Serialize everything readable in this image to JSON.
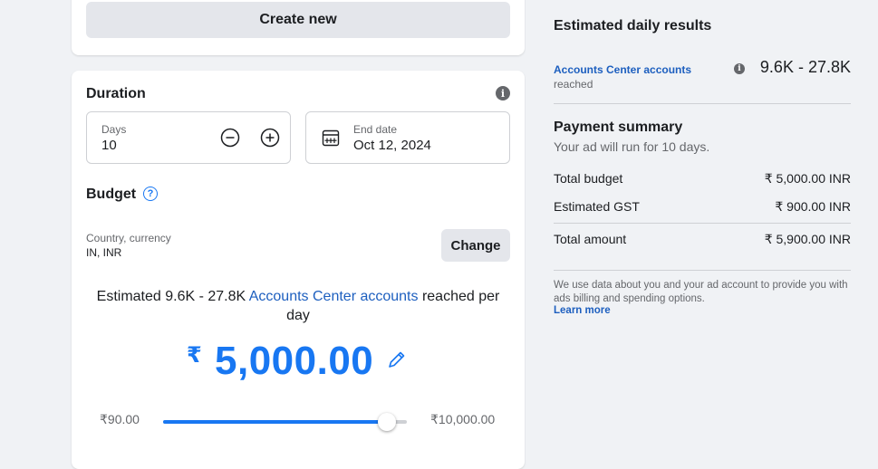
{
  "create_card": {
    "create_button_label": "Create new"
  },
  "duration": {
    "title": "Duration",
    "days_label": "Days",
    "days_value": "10",
    "end_date_label": "End date",
    "end_date_value": "Oct 12, 2024"
  },
  "budget": {
    "title": "Budget",
    "country_label": "Country, currency",
    "country_value": "IN, INR",
    "change_button_label": "Change",
    "estimate_prefix": "Estimated 9.6K - 27.8K ",
    "estimate_link": "Accounts Center accounts",
    "estimate_suffix": " reached per day",
    "currency_symbol": "₹",
    "amount": "5,000.00",
    "min_label": "₹90.00",
    "max_label": "₹10,000.00",
    "slider_position_pct": 92
  },
  "results": {
    "title": "Estimated daily results",
    "accounts_link": "Accounts Center accounts",
    "reached_label": "reached",
    "reach_range": "9.6K - 27.8K"
  },
  "payment": {
    "title": "Payment summary",
    "description": "Your ad will run for 10 days.",
    "rows": [
      {
        "label": "Total budget",
        "value": "₹ 5,000.00 INR"
      },
      {
        "label": "Estimated GST",
        "value": "₹ 900.00 INR"
      },
      {
        "label": "Total amount",
        "value": "₹ 5,900.00 INR"
      }
    ],
    "note": "We use data about you and your ad account to provide you with ads billing and spending options.",
    "learn_more": "Learn more"
  },
  "colors": {
    "accent": "#1877f2",
    "link": "#1d5fbf",
    "page_bg": "#f0f2f5"
  }
}
